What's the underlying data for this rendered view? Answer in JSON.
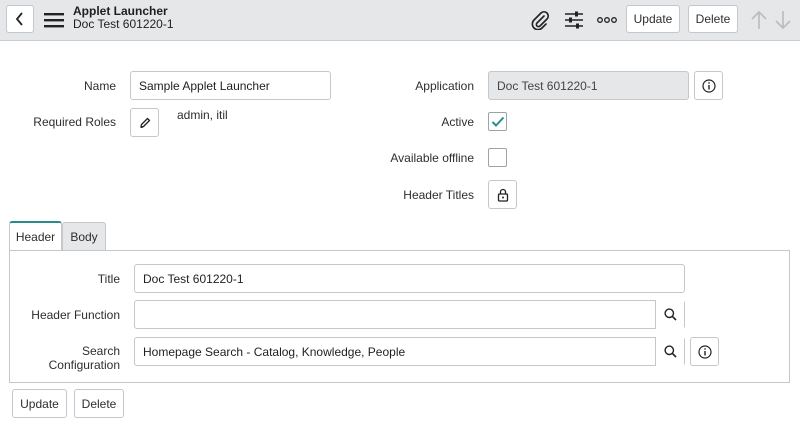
{
  "header": {
    "back_icon": "chevron-left-icon",
    "menu_icon": "hamburger-icon",
    "title": "Applet Launcher",
    "subtitle": "Doc Test 601220-1",
    "attach_icon": "paperclip-icon",
    "settings_icon": "sliders-icon",
    "more_icon": "more-dots-icon",
    "update_label": "Update",
    "delete_label": "Delete",
    "prev_icon": "arrow-up-icon",
    "next_icon": "arrow-down-icon"
  },
  "form": {
    "name_label": "Name",
    "name_value": "Sample Applet Launcher",
    "required_roles_label": "Required Roles",
    "required_roles_value": "admin, itil",
    "application_label": "Application",
    "application_value": "Doc Test 601220-1",
    "active_label": "Active",
    "active_checked": true,
    "available_offline_label": "Available offline",
    "available_offline_checked": false,
    "header_titles_label": "Header Titles"
  },
  "tabs": [
    {
      "label": "Header",
      "active": true
    },
    {
      "label": "Body",
      "active": false
    }
  ],
  "header_tab": {
    "title_label": "Title",
    "title_value": "Doc Test 601220-1",
    "header_function_label": "Header Function",
    "header_function_value": "",
    "search_configuration_label": "Search Configuration",
    "search_configuration_value": "Homepage Search - Catalog, Knowledge, People"
  },
  "footer": {
    "update_label": "Update",
    "delete_label": "Delete"
  },
  "colors": {
    "header_bg": "#e5e7e9",
    "tab_accent": "#2a8b8c",
    "check_color": "#2a8b8c"
  }
}
